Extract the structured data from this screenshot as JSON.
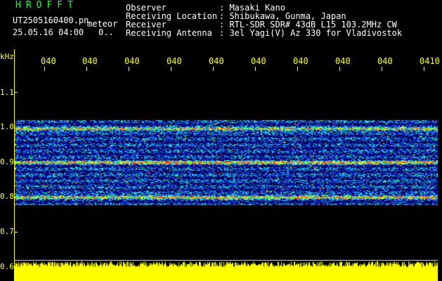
{
  "header": {
    "app_title": "HROFFT",
    "file_name": "UT2505160400.pn",
    "meteor_label": "meteor",
    "date_time": "25.05.16 04:00",
    "detection_value": "0..",
    "fields": [
      {
        "label": "Observer",
        "value": ": Masaki Kano"
      },
      {
        "label": "Receiving Location",
        "value": ": Shibukawa, Gunma, Japan"
      },
      {
        "label": "Receiver",
        "value": ": RTL-SDR SDR# 43dB L15 103.2MHz CW"
      },
      {
        "label": "Receiving Antenna",
        "value": ": 3el Yagi(V) Az 330 for Vladivostok"
      }
    ]
  },
  "colors": {
    "background": "#000000",
    "title": "#20ff40",
    "axis": "#ffff40",
    "text": "#ffffff",
    "spectrum_low": "#000080",
    "spectrum_high": "#ff2020",
    "level_trace": "#ffff00"
  },
  "chart_data": {
    "type": "heatmap",
    "ylabel": "kHz",
    "y_ticks": [
      "1.1",
      "1.0",
      "0.9",
      "0.8",
      "0.7",
      "0.6"
    ],
    "ylim": [
      0.6,
      1.18
    ],
    "x_ticks": [
      "040",
      "040",
      "040",
      "040",
      "040",
      "040",
      "040",
      "040",
      "040",
      "0410"
    ],
    "band_khz": [
      0.775,
      1.02
    ],
    "strong_lines_khz": [
      0.995,
      0.9,
      0.8
    ],
    "level_trace": "yellow noise floor at 0.6 kHz baseline"
  }
}
